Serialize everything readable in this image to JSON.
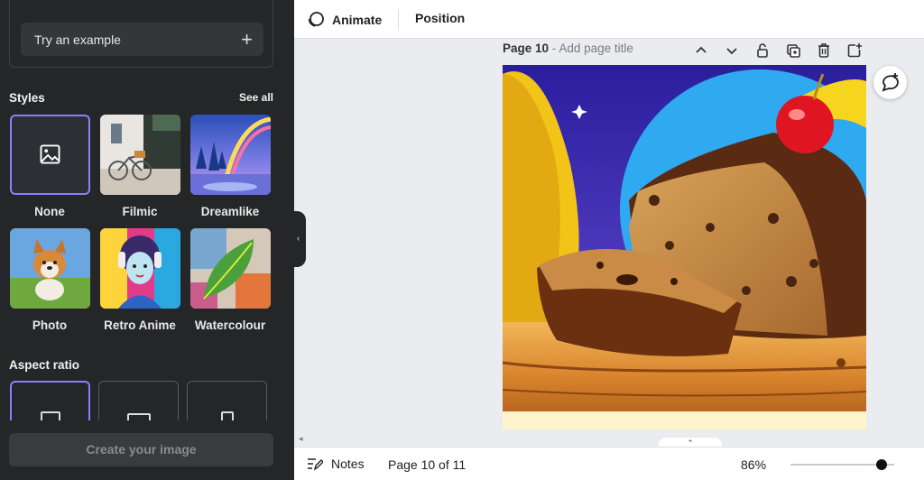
{
  "sidebar": {
    "try_example_label": "Try an example",
    "styles_heading": "Styles",
    "see_all_label": "See all",
    "styles": [
      {
        "label": "None",
        "icon": "image-icon",
        "selected": true
      },
      {
        "label": "Filmic"
      },
      {
        "label": "Dreamlike"
      },
      {
        "label": "Photo"
      },
      {
        "label": "Retro Anime"
      },
      {
        "label": "Watercolour"
      }
    ],
    "aspect_heading": "Aspect ratio",
    "create_label": "Create your image"
  },
  "toolbar": {
    "animate_label": "Animate",
    "position_label": "Position"
  },
  "page": {
    "name": "Page 10",
    "separator": " - ",
    "title_placeholder": "Add page title"
  },
  "bottom": {
    "notes_label": "Notes",
    "page_indicator": "Page 10 of 11",
    "zoom_label": "86%",
    "zoom_fraction": 0.86
  },
  "colors": {
    "accent": "#8b7fff",
    "sidebar_bg": "#252627"
  }
}
